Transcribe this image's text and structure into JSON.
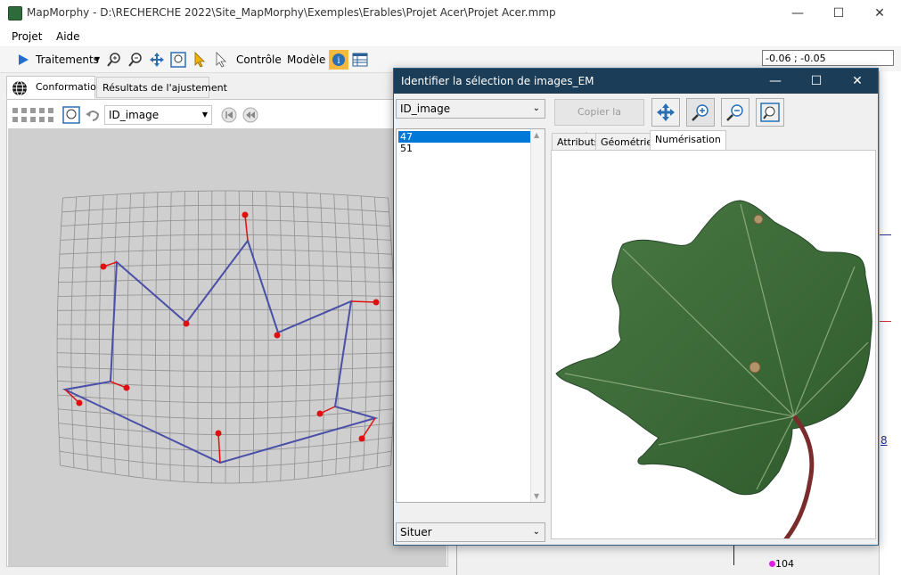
{
  "window": {
    "title": "MapMorphy - D:\\RECHERCHE 2022\\Site_MapMorphy\\Exemples\\Erables\\Projet Acer\\Projet Acer.mmp",
    "minimize": "—",
    "maximize": "☐",
    "close": "✕"
  },
  "menu": [
    "Projet",
    "Aide"
  ],
  "toolbar": {
    "traitements": "Traitements",
    "controle": "Contrôle",
    "modele": "Modèle",
    "coord": "-0.06 ; -0.05"
  },
  "left_panel": {
    "tabs": [
      "Conformation",
      "Résultats de l'ajustement"
    ],
    "id_select": "ID_image"
  },
  "dialog": {
    "title": "Identifier la sélection de images_EM",
    "minimize": "—",
    "maximize": "☐",
    "close": "✕",
    "id_select": "ID_image",
    "list_items": [
      "47",
      "51"
    ],
    "situer_select": "Situer",
    "copy_button": "Copier la sélection",
    "tabs": [
      "Attributs",
      "Géométrie",
      "Numérisation"
    ]
  },
  "right_strip": {
    "value_8": "8",
    "value_104": "104"
  },
  "colors": {
    "accent": "#0078d7",
    "dialog_title_bg": "#1c3d57",
    "shape_line": "#4a4fa8",
    "landmark": "#e01010",
    "leaf_green": "#3d6b3a"
  }
}
